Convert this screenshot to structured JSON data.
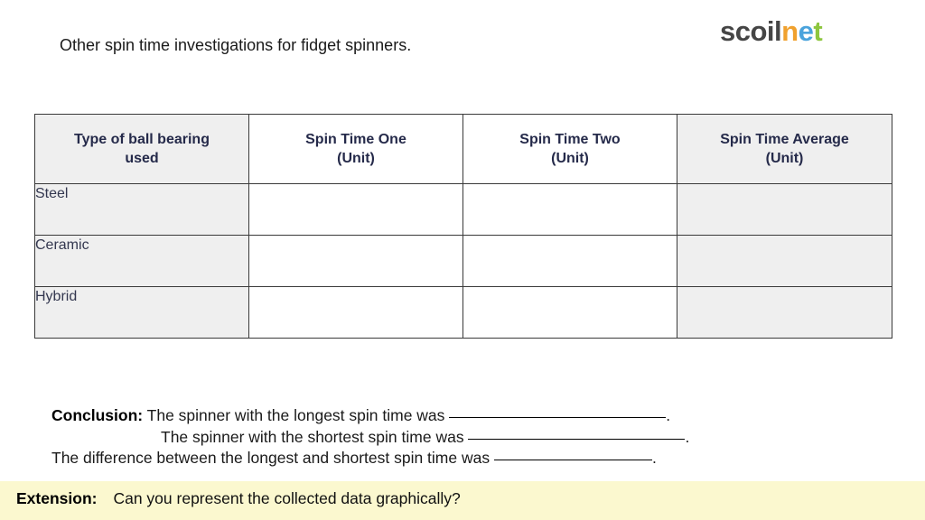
{
  "logo": {
    "name": "scoilnet-logo",
    "parts": [
      {
        "text": "scoil",
        "color": "#454545"
      },
      {
        "text": "n",
        "color": "#f0a12e"
      },
      {
        "text": "e",
        "color": "#4aa3dc"
      },
      {
        "text": "t",
        "color": "#8dc63f"
      }
    ]
  },
  "slide": {
    "title": "Other spin time investigations for fidget spinners."
  },
  "table": {
    "headers": [
      {
        "line1": "Type of ball bearing",
        "line2": "used",
        "shaded": true
      },
      {
        "line1": "Spin Time One",
        "line2": "(Unit)",
        "shaded": false
      },
      {
        "line1": "Spin Time Two",
        "line2": "(Unit)",
        "shaded": false
      },
      {
        "line1": "Spin Time Average",
        "line2": "(Unit)",
        "shaded": true
      }
    ],
    "rows": [
      {
        "label": "Steel",
        "cells": [
          "",
          "",
          ""
        ]
      },
      {
        "label": "Ceramic",
        "cells": [
          "",
          "",
          ""
        ]
      },
      {
        "label": "Hybrid",
        "cells": [
          "",
          "",
          ""
        ]
      }
    ]
  },
  "conclusion": {
    "label": "Conclusion:",
    "line1_text": "The spinner with the longest spin time was",
    "line1_end": ".",
    "line2_text": "The spinner with the shortest spin time was",
    "line2_end": ".",
    "line3_text": "The difference between the longest and shortest spin time was",
    "line3_end": "."
  },
  "extension": {
    "label": "Extension:",
    "text": "Can you represent the collected data graphically?",
    "background_color": "#fbf8cf"
  },
  "colors": {
    "header_text": "#252a4a",
    "row_label_text": "#33374f",
    "cell_shaded": "#efefef",
    "table_border": "#3a3a3a",
    "page_background": "#ffffff"
  }
}
